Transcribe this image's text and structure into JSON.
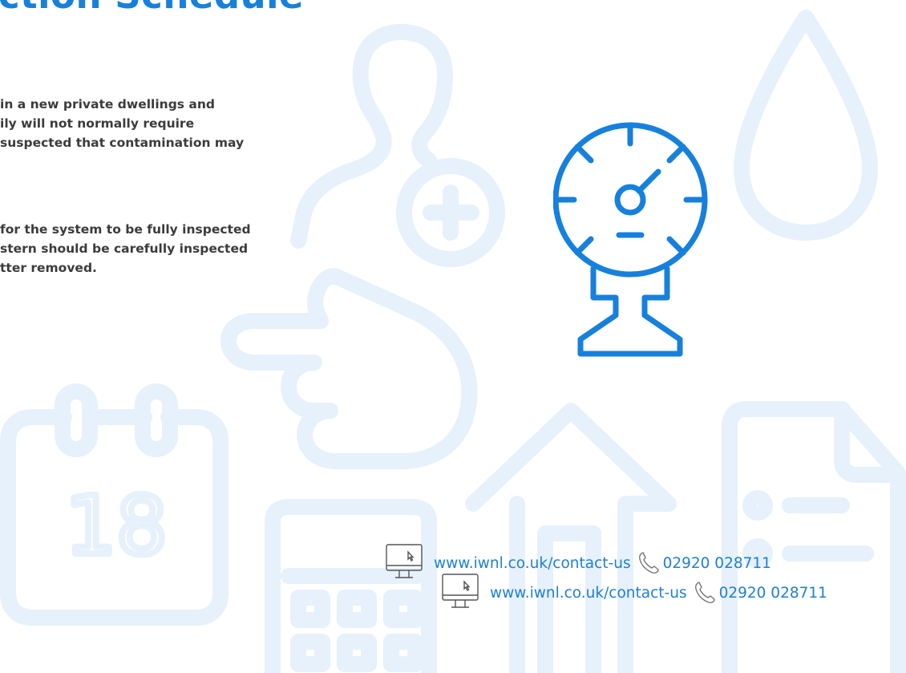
{
  "page": {
    "title": "ction Schedule",
    "paragraphs": [
      [
        "in a new private dwellings and",
        "ily will not normally require",
        "suspected that contamination may"
      ],
      [
        "for the system to be fully inspected",
        "stern should be carefully inspected",
        "tter removed."
      ]
    ],
    "calendar_day": "18"
  },
  "contacts": [
    {
      "url": "www.iwnl.co.uk/contact-us",
      "phone": "02920 028711"
    },
    {
      "url": "www.iwnl.co.uk/contact-us",
      "phone": "02920 028711"
    }
  ],
  "icons": [
    "person-icon",
    "plus-icon",
    "pointing-hand-icon",
    "water-drop-icon",
    "pressure-gauge-icon",
    "calendar-icon",
    "calculator-icon",
    "house-icon",
    "document-icon",
    "monitor-icon",
    "phone-icon"
  ],
  "colors": {
    "accent": "#1680dd",
    "watermark": "#e6f1fc",
    "body_text": "#3b3b3b",
    "link": "#1e7fd8"
  }
}
